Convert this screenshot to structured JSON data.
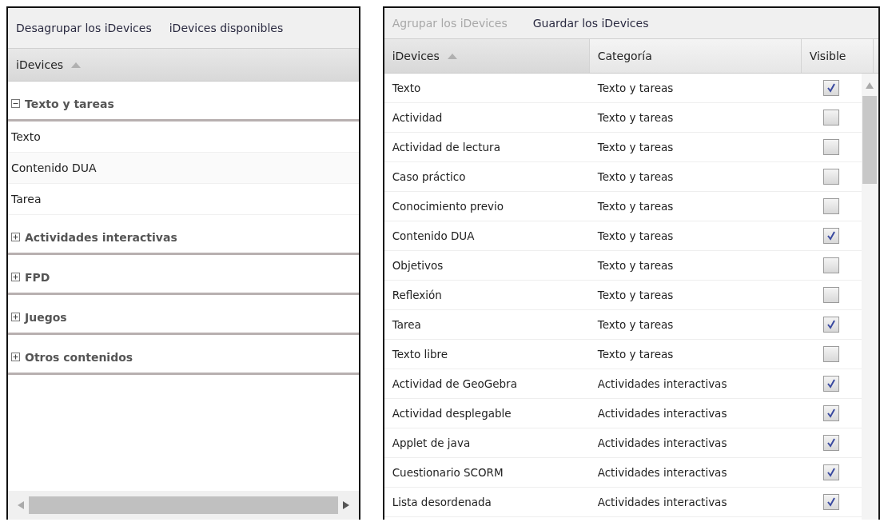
{
  "left_panel": {
    "toolbar": [
      {
        "label": "Desagrupar los iDevices",
        "disabled": false
      },
      {
        "label": "iDevices disponibles",
        "disabled": false
      }
    ],
    "header": {
      "label": "iDevices",
      "sorted": true
    },
    "groups": [
      {
        "label": "Texto y tareas",
        "expanded": true,
        "children": [
          {
            "label": "Texto"
          },
          {
            "label": "Contenido DUA"
          },
          {
            "label": "Tarea"
          }
        ]
      },
      {
        "label": "Actividades interactivas",
        "expanded": false
      },
      {
        "label": "FPD",
        "expanded": false
      },
      {
        "label": "Juegos",
        "expanded": false
      },
      {
        "label": "Otros contenidos",
        "expanded": false
      }
    ]
  },
  "right_panel": {
    "toolbar": [
      {
        "label": "Agrupar los iDevices",
        "disabled": true
      },
      {
        "label": "Guardar los iDevices",
        "disabled": false
      }
    ],
    "columns": [
      {
        "label": "iDevices",
        "sorted": true
      },
      {
        "label": "Categoría",
        "sorted": false
      },
      {
        "label": "Visible",
        "sorted": false
      }
    ],
    "rows": [
      {
        "name": "Texto",
        "category": "Texto y tareas",
        "checked": true
      },
      {
        "name": "Actividad",
        "category": "Texto y tareas",
        "checked": false
      },
      {
        "name": "Actividad de lectura",
        "category": "Texto y tareas",
        "checked": false
      },
      {
        "name": "Caso práctico",
        "category": "Texto y tareas",
        "checked": false
      },
      {
        "name": "Conocimiento previo",
        "category": "Texto y tareas",
        "checked": false
      },
      {
        "name": "Contenido DUA",
        "category": "Texto y tareas",
        "checked": true
      },
      {
        "name": "Objetivos",
        "category": "Texto y tareas",
        "checked": false
      },
      {
        "name": "Reflexión",
        "category": "Texto y tareas",
        "checked": false
      },
      {
        "name": "Tarea",
        "category": "Texto y tareas",
        "checked": true
      },
      {
        "name": "Texto libre",
        "category": "Texto y tareas",
        "checked": false
      },
      {
        "name": "Actividad de GeoGebra",
        "category": "Actividades interactivas",
        "checked": true
      },
      {
        "name": "Actividad desplegable",
        "category": "Actividades interactivas",
        "checked": true
      },
      {
        "name": "Applet de java",
        "category": "Actividades interactivas",
        "checked": true
      },
      {
        "name": "Cuestionario SCORM",
        "category": "Actividades interactivas",
        "checked": true
      },
      {
        "name": "Lista desordenada",
        "category": "Actividades interactivas",
        "checked": true
      }
    ]
  }
}
